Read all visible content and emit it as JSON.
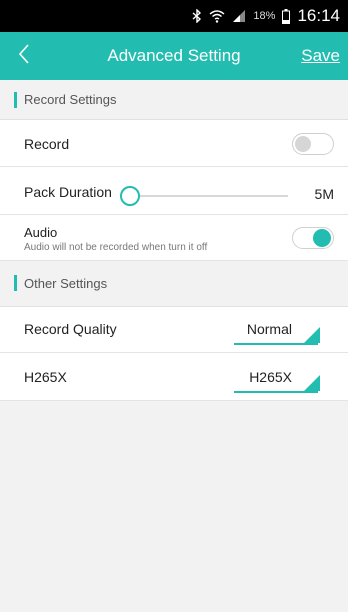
{
  "status_bar": {
    "battery_percent": "18%",
    "time": "16:14",
    "icons": [
      "bluetooth-icon",
      "wifi-icon",
      "signal-icon",
      "battery-icon"
    ]
  },
  "header": {
    "title": "Advanced Setting",
    "save_label": "Save",
    "back_icon": "chevron-left-icon"
  },
  "record_section": {
    "title": "Record Settings",
    "record": {
      "label": "Record",
      "enabled": false
    },
    "pack_duration": {
      "label": "Pack Duration",
      "value": "5M",
      "slider_fraction": 0
    },
    "audio": {
      "label": "Audio",
      "description": "Audio will not be recorded when turn it off",
      "enabled": true
    }
  },
  "other_section": {
    "title": "Other Settings",
    "record_quality": {
      "label": "Record Quality",
      "value": "Normal"
    },
    "h265x": {
      "label": "H265X",
      "value": "H265X"
    }
  },
  "colors": {
    "accent": "#22bdb0",
    "background": "#f2f2f2"
  }
}
